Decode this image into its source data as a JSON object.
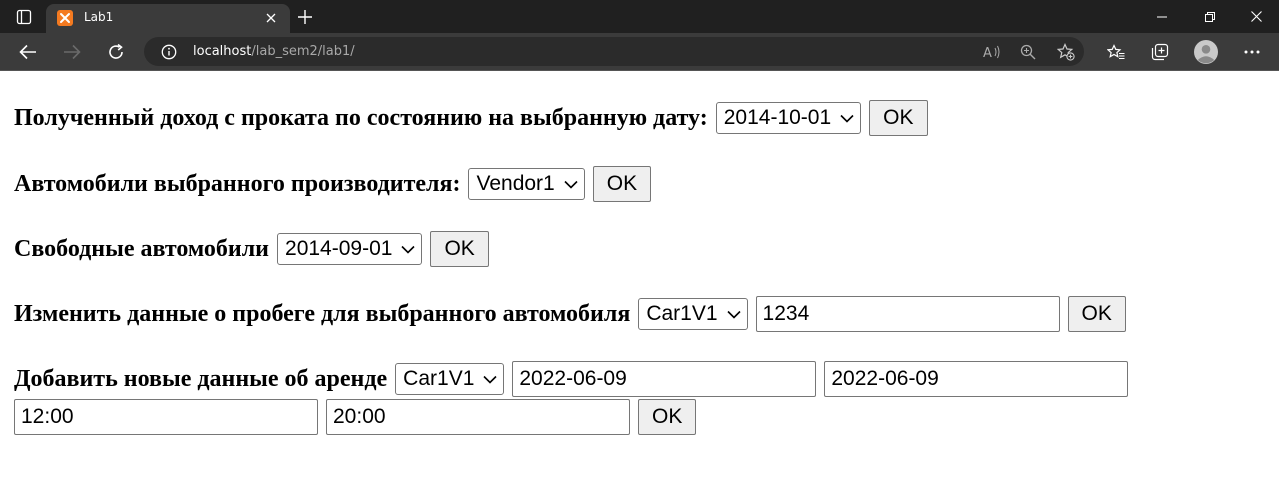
{
  "browser": {
    "tab_title": "Lab1",
    "url_host": "localhost",
    "url_path": "/lab_sem2/lab1/",
    "favicon_color": "#f47a20",
    "icons": [
      "tab-actions-icon",
      "close-icon",
      "plus-icon",
      "minimize-icon",
      "restore-icon",
      "close-window-icon",
      "back-arrow-icon",
      "forward-arrow-icon",
      "refresh-icon",
      "info-icon",
      "read-aloud-icon",
      "zoom-icon",
      "add-favorite-icon",
      "favorites-icon",
      "collections-icon",
      "profile-avatar-icon",
      "more-icon"
    ]
  },
  "forms": {
    "income": {
      "label": "Полученный доход с проката по состоянию на выбранную дату:",
      "date_select": "2014-10-01",
      "button": "OK"
    },
    "vendor_cars": {
      "label": "Автомобили выбранного производителя:",
      "vendor_select": "Vendor1",
      "button": "OK"
    },
    "free_cars": {
      "label": "Свободные автомобили",
      "date_select": "2014-09-01",
      "button": "OK"
    },
    "mileage": {
      "label": "Изменить данные о пробеге для выбранного автомобиля",
      "car_select": "Car1V1",
      "mileage_value": "1234",
      "button": "OK"
    },
    "rental": {
      "label": "Добавить новые данные об аренде",
      "car_select": "Car1V1",
      "start_date": "2022-06-09",
      "end_date": "2022-06-09",
      "start_time": "12:00",
      "end_time": "20:00",
      "button": "OK"
    }
  }
}
